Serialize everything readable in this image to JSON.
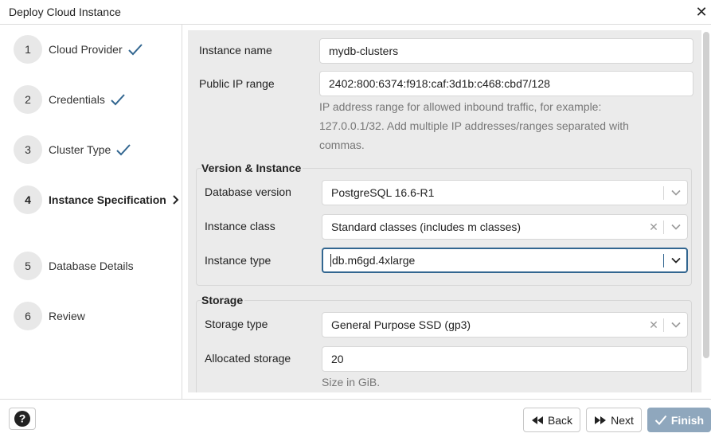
{
  "window": {
    "title": "Deploy Cloud Instance",
    "close_label": "✕"
  },
  "steps": [
    {
      "number": "1",
      "label": "Cloud Provider",
      "state": "done"
    },
    {
      "number": "2",
      "label": "Credentials",
      "state": "done"
    },
    {
      "number": "3",
      "label": "Cluster Type",
      "state": "done"
    },
    {
      "number": "4",
      "label": "Instance Specification",
      "state": "active"
    },
    {
      "number": "5",
      "label": "Database Details",
      "state": "pending"
    },
    {
      "number": "6",
      "label": "Review",
      "state": "pending"
    }
  ],
  "form": {
    "instance_name": {
      "label": "Instance name",
      "value": "mydb-clusters"
    },
    "public_ip": {
      "label": "Public IP range",
      "value": "2402:800:6374:f918:caf:3d1b:c468:cbd7/128",
      "help_lines": [
        "IP address range for allowed inbound traffic, for example:",
        "127.0.0.1/32. Add multiple IP addresses/ranges separated with",
        "commas."
      ]
    },
    "version_group": {
      "title": "Version & Instance",
      "db_version": {
        "label": "Database version",
        "value": "PostgreSQL 16.6-R1"
      },
      "instance_class": {
        "label": "Instance class",
        "value": "Standard classes (includes m classes)"
      },
      "instance_type": {
        "label": "Instance type",
        "value": "db.m6gd.4xlarge"
      }
    },
    "storage_group": {
      "title": "Storage",
      "storage_type": {
        "label": "Storage type",
        "value": "General Purpose SSD (gp3)"
      },
      "allocated_storage": {
        "label": "Allocated storage",
        "value": "20",
        "help": "Size in GiB."
      }
    }
  },
  "footer": {
    "help_label": "?",
    "back_label": "Back",
    "next_label": "Next",
    "finish_label": "Finish"
  },
  "colors": {
    "accent": "#326690",
    "check": "#326690",
    "finish_bg": "#8fa7bd",
    "panel_bg": "#ebebeb"
  }
}
